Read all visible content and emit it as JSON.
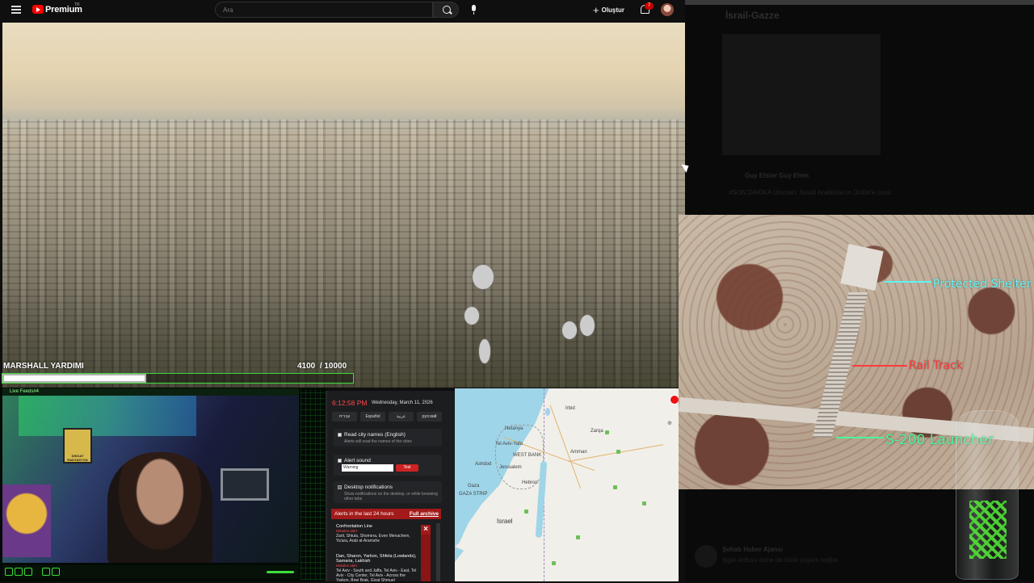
{
  "youtube": {
    "brand": "Premium",
    "region": "TR",
    "search_placeholder": "Ara",
    "create_label": "Oluştur",
    "notification_count": "7"
  },
  "stream": {
    "goal_label": "MARSHALL YARDIMI",
    "goal_current": "4100",
    "goal_separator": "/",
    "goal_total": "10000",
    "goal_progress": 0.41,
    "webcam_title": "Live Feeds#4",
    "poster_text": "DİKKAT RADYASYON"
  },
  "feed": {
    "title": "İsrail-Gazze",
    "author": "Guy Elster Guy Elem",
    "post_text": "#SON DAKİKA Umman: Suudi Arabistan'ın Ürdün'e üssü",
    "second_author": "Şehab Haber Ajansı",
    "second_text": "İşgal ordusu daha da fazla yaşam sağlar"
  },
  "satellite": {
    "label_shelter": "Protected Shelter",
    "label_rail": "Rail Track",
    "label_launcher": "S-200 Launcher",
    "color_shelter": "#5cf5f5",
    "color_rail": "#ff3b3b",
    "color_launcher": "#4df59a"
  },
  "alerts": {
    "time": "6:12:58 PM",
    "date": "Wednesday, March 11, 2026",
    "languages": [
      "עברית",
      "Español",
      "عربية",
      "русский"
    ],
    "read_names_title": "Read city names (English)",
    "read_names_desc": "Alerts will read the names of the cities",
    "alert_sound_title": "Alert sound",
    "sound_option": "Warning",
    "test_label": "Test",
    "desktop_title": "Desktop notifications",
    "desktop_desc": "Show notifications on the desktop, or while browsing other tabs",
    "history_title": "Alerts in the last 24 hours",
    "archive_label": "Full archive",
    "items": [
      {
        "heading": "Confrontation Line",
        "time": "Missiles alert",
        "body": "Zarit, Shtula, Shomera, Even Menachem, Ya'ara, Arab al-Aramshe"
      },
      {
        "heading": "Dan, Sharon, Yarkon, Shfela (Lowlands), Samaria, Lakhish",
        "time": "Missiles alert",
        "body": "Tel Aviv - South and Jaffa, Tel Aviv - East, Tel Aviv - City Center, Tel Aviv - Across the Yarkon, Bnei Brak, Givat Shmuel"
      }
    ]
  },
  "map": {
    "labels": [
      "Netanya",
      "Tel Aviv-Yafo",
      "Ashdod",
      "Jerusalem",
      "WEST BANK",
      "Hebron",
      "Gaza",
      "GAZA STRIP",
      "Amman",
      "Irbid",
      "Israel",
      "Zarqa"
    ]
  }
}
